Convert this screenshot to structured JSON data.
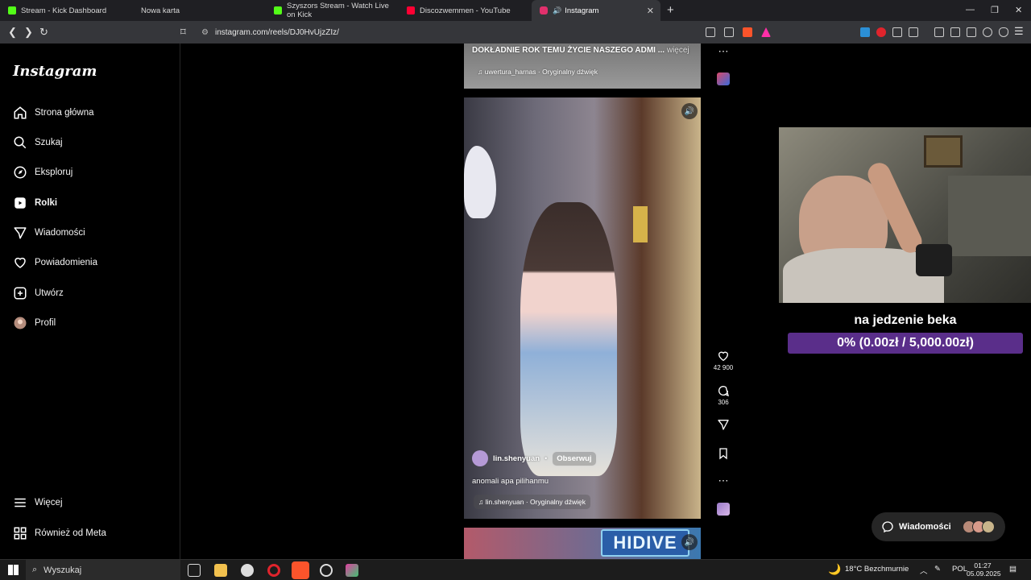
{
  "browser": {
    "tabs": [
      {
        "label": "Stream - Kick Dashboard",
        "color": "#53fc18"
      },
      {
        "label": "Nowa karta",
        "color": "#444"
      },
      {
        "label": "Szyszors Stream - Watch Live on Kick",
        "color": "#53fc18"
      },
      {
        "label": "Discozwemmen - YouTube",
        "color": "#ff0033"
      },
      {
        "label": "Instagram",
        "color": "#e1306c"
      }
    ],
    "url": "instagram.com/reels/DJ0HvUjzZIz/"
  },
  "sidebar": {
    "logo": "Instagram",
    "items": [
      {
        "label": "Strona główna",
        "icon": "home-icon"
      },
      {
        "label": "Szukaj",
        "icon": "search-icon"
      },
      {
        "label": "Eksploruj",
        "icon": "compass-icon"
      },
      {
        "label": "Rolki",
        "icon": "reels-icon"
      },
      {
        "label": "Wiadomości",
        "icon": "send-icon"
      },
      {
        "label": "Powiadomienia",
        "icon": "heart-icon"
      },
      {
        "label": "Utwórz",
        "icon": "plus-square-icon"
      },
      {
        "label": "Profil",
        "icon": "avatar"
      }
    ],
    "more": "Więcej",
    "meta": "Również od Meta"
  },
  "reel_top": {
    "caption": "DOKŁADNIE ROK TEMU ŻYCIE NASZEGO ADMI ...",
    "more": "więcej",
    "audio": "uwertura_harnas · Oryginalny dźwięk"
  },
  "reel_main": {
    "username": "lin.shenyuan",
    "follow": "Obserwuj",
    "caption": "anomali apa pilihanmu",
    "audio": "lin.shenyuan · Oryginalny dźwięk",
    "likes": "42 900",
    "comments": "306"
  },
  "reel_bottom": {
    "logo_text": "HIDIVE"
  },
  "stream_overlay": {
    "goal_title": "na jedzenie beka",
    "goal_progress": "0% (0.00zł / 5,000.00zł)",
    "goal_fraction": 0
  },
  "messages_button": "Wiadomości",
  "taskbar": {
    "search": "Wyszukaj",
    "weather": "18°C  Bezchmurnie",
    "lang": "POL",
    "time": "01:27",
    "date": "05.09.2025"
  }
}
